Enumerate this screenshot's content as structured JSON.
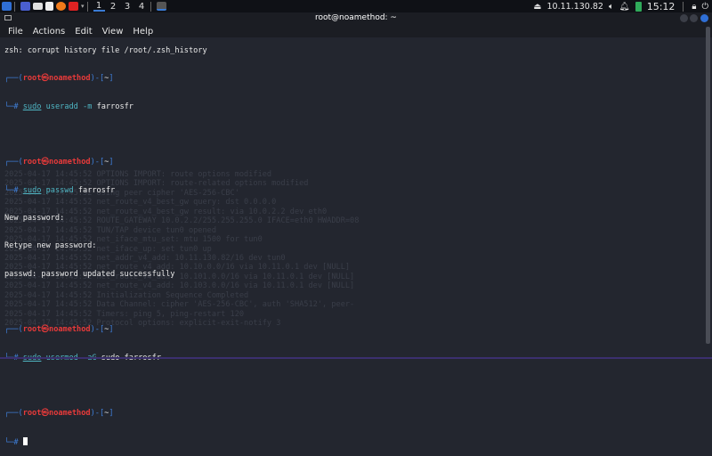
{
  "panel": {
    "workspaces": [
      "1",
      "2",
      "3",
      "4"
    ],
    "ip": "10.11.130.82",
    "time": "15:12"
  },
  "window": {
    "title": "root@noamethod: ~"
  },
  "menu": [
    "File",
    "Actions",
    "Edit",
    "View",
    "Help"
  ],
  "terminal": {
    "warning": "zsh: corrupt history file /root/.zsh_history",
    "user": "root",
    "host": "noamethod",
    "dir": "~",
    "cmd1": {
      "a": "sudo",
      "b": "useradd",
      "c": "-m",
      "d": "farrosfr"
    },
    "cmd2": {
      "a": "sudo",
      "b": "passwd",
      "d": "farrosfr"
    },
    "out": [
      "New password:",
      "Retype new password:",
      "passwd: password updated successfully"
    ],
    "cmd3": {
      "a": "sudo",
      "b": "usermod",
      "c": "-aG",
      "d": "sudo farrosfr"
    }
  },
  "ghost": [
    "2025-04-17 14:45:52 OPTIONS IMPORT: route options modified",
    "2025-04-17 14:45:52 OPTIONS IMPORT: route-related options modified",
    "2025-04-17 14:45:52 Using peer cipher 'AES-256-CBC'",
    "2025-04-17 14:45:52 net_route_v4_best_gw query: dst 0.0.0.0",
    "2025-04-17 14:45:52 net_route_v4_best_gw result: via 10.0.2.2 dev eth0",
    "2025-04-17 14:45:52 ROUTE_GATEWAY 10.0.2.2/255.255.255.0 IFACE=eth0 HWADDR=08",
    "2025-04-17 14:45:52 TUN/TAP device tun0 opened",
    "2025-04-17 14:45:52 net_iface_mtu_set: mtu 1500 for tun0",
    "2025-04-17 14:45:52 net_iface_up: set tun0 up",
    "2025-04-17 14:45:52 net_addr_v4_add: 10.11.130.82/16 dev tun0",
    "2025-04-17 14:45:52 net_route_v4_add: 10.10.0.0/16 via 10.11.0.1 dev [NULL]",
    "2025-04-17 14:45:52 net_route_v4_add: 10.101.0.0/16 via 10.11.0.1 dev [NULL]",
    "2025-04-17 14:45:52 net_route_v4_add: 10.103.0.0/16 via 10.11.0.1 dev [NULL]",
    "2025-04-17 14:45:52 Initialization Sequence Completed",
    "2025-04-17 14:45:52 Data Channel: cipher 'AES-256-CBC', auth 'SHA512', peer-",
    "2025-04-17 14:45:52 Timers: ping 5, ping-restart 120",
    "2025-04-17 14:45:52 Protocol options: explicit-exit-notify 3"
  ]
}
